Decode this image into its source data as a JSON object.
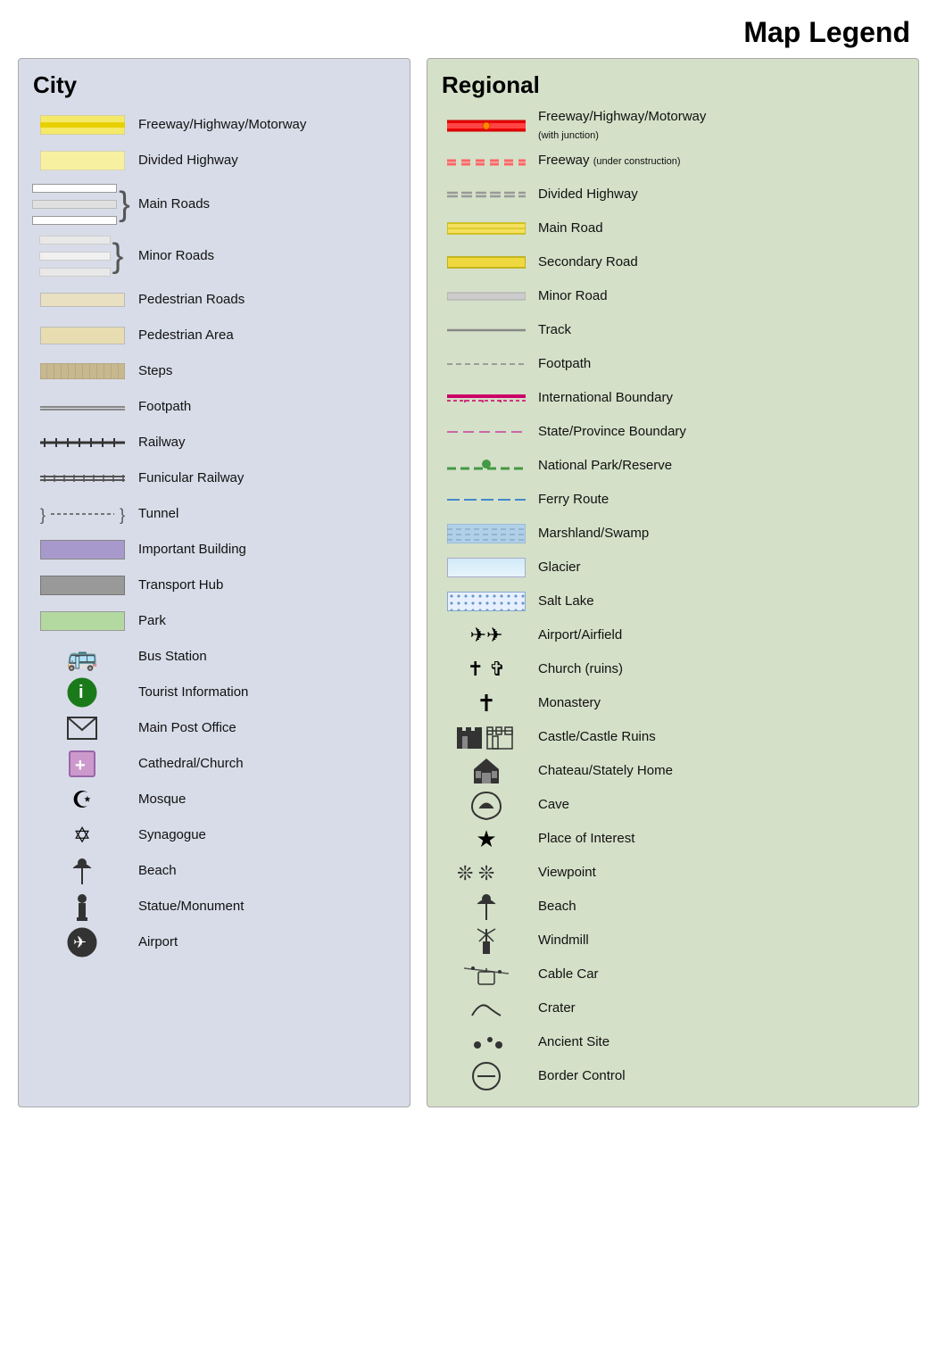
{
  "title": "Map Legend",
  "city": {
    "heading": "City",
    "items": [
      {
        "id": "freeway",
        "label": "Freeway/Highway/Motorway"
      },
      {
        "id": "divided-highway",
        "label": "Divided Highway"
      },
      {
        "id": "main-roads",
        "label": "Main Roads"
      },
      {
        "id": "minor-roads",
        "label": "Minor Roads"
      },
      {
        "id": "pedestrian-roads",
        "label": "Pedestrian Roads"
      },
      {
        "id": "pedestrian-area",
        "label": "Pedestrian Area"
      },
      {
        "id": "steps",
        "label": "Steps"
      },
      {
        "id": "footpath",
        "label": "Footpath"
      },
      {
        "id": "railway",
        "label": "Railway"
      },
      {
        "id": "funicular",
        "label": "Funicular Railway"
      },
      {
        "id": "tunnel",
        "label": "Tunnel"
      },
      {
        "id": "important-building",
        "label": "Important Building"
      },
      {
        "id": "transport-hub",
        "label": "Transport Hub"
      },
      {
        "id": "park",
        "label": "Park"
      },
      {
        "id": "bus-station",
        "label": "Bus Station"
      },
      {
        "id": "tourist-info",
        "label": "Tourist Information"
      },
      {
        "id": "main-post",
        "label": "Main Post Office"
      },
      {
        "id": "cathedral",
        "label": "Cathedral/Church"
      },
      {
        "id": "mosque",
        "label": "Mosque"
      },
      {
        "id": "synagogue",
        "label": "Synagogue"
      },
      {
        "id": "beach",
        "label": "Beach"
      },
      {
        "id": "statue",
        "label": "Statue/Monument"
      },
      {
        "id": "airport-city",
        "label": "Airport"
      }
    ]
  },
  "regional": {
    "heading": "Regional",
    "items": [
      {
        "id": "reg-freeway",
        "label": "Freeway/Highway/Motorway",
        "sub": "(with junction)"
      },
      {
        "id": "reg-freeway-under",
        "label": "Freeway",
        "sub": "(under construction)"
      },
      {
        "id": "reg-divided",
        "label": "Divided Highway"
      },
      {
        "id": "reg-main",
        "label": "Main Road"
      },
      {
        "id": "reg-secondary",
        "label": "Secondary Road"
      },
      {
        "id": "reg-minor",
        "label": "Minor Road"
      },
      {
        "id": "reg-track",
        "label": "Track"
      },
      {
        "id": "reg-footpath",
        "label": "Footpath"
      },
      {
        "id": "reg-intl-boundary",
        "label": "International Boundary"
      },
      {
        "id": "reg-state-boundary",
        "label": "State/Province Boundary"
      },
      {
        "id": "reg-national-park",
        "label": "National Park/Reserve"
      },
      {
        "id": "reg-ferry",
        "label": "Ferry Route"
      },
      {
        "id": "reg-marshland",
        "label": "Marshland/Swamp"
      },
      {
        "id": "reg-glacier",
        "label": "Glacier"
      },
      {
        "id": "reg-salt-lake",
        "label": "Salt Lake"
      },
      {
        "id": "reg-airport",
        "label": "Airport/Airfield"
      },
      {
        "id": "reg-church",
        "label": "Church (ruins)"
      },
      {
        "id": "reg-monastery",
        "label": "Monastery"
      },
      {
        "id": "reg-castle",
        "label": "Castle/Castle Ruins"
      },
      {
        "id": "reg-chateau",
        "label": "Chateau/Stately Home"
      },
      {
        "id": "reg-cave",
        "label": "Cave"
      },
      {
        "id": "reg-place",
        "label": "Place of Interest"
      },
      {
        "id": "reg-viewpoint",
        "label": "Viewpoint"
      },
      {
        "id": "reg-beach",
        "label": "Beach"
      },
      {
        "id": "reg-windmill",
        "label": "Windmill"
      },
      {
        "id": "reg-cablecar",
        "label": "Cable Car"
      },
      {
        "id": "reg-crater",
        "label": "Crater"
      },
      {
        "id": "reg-ancient",
        "label": "Ancient Site"
      },
      {
        "id": "reg-border",
        "label": "Border Control"
      }
    ]
  }
}
